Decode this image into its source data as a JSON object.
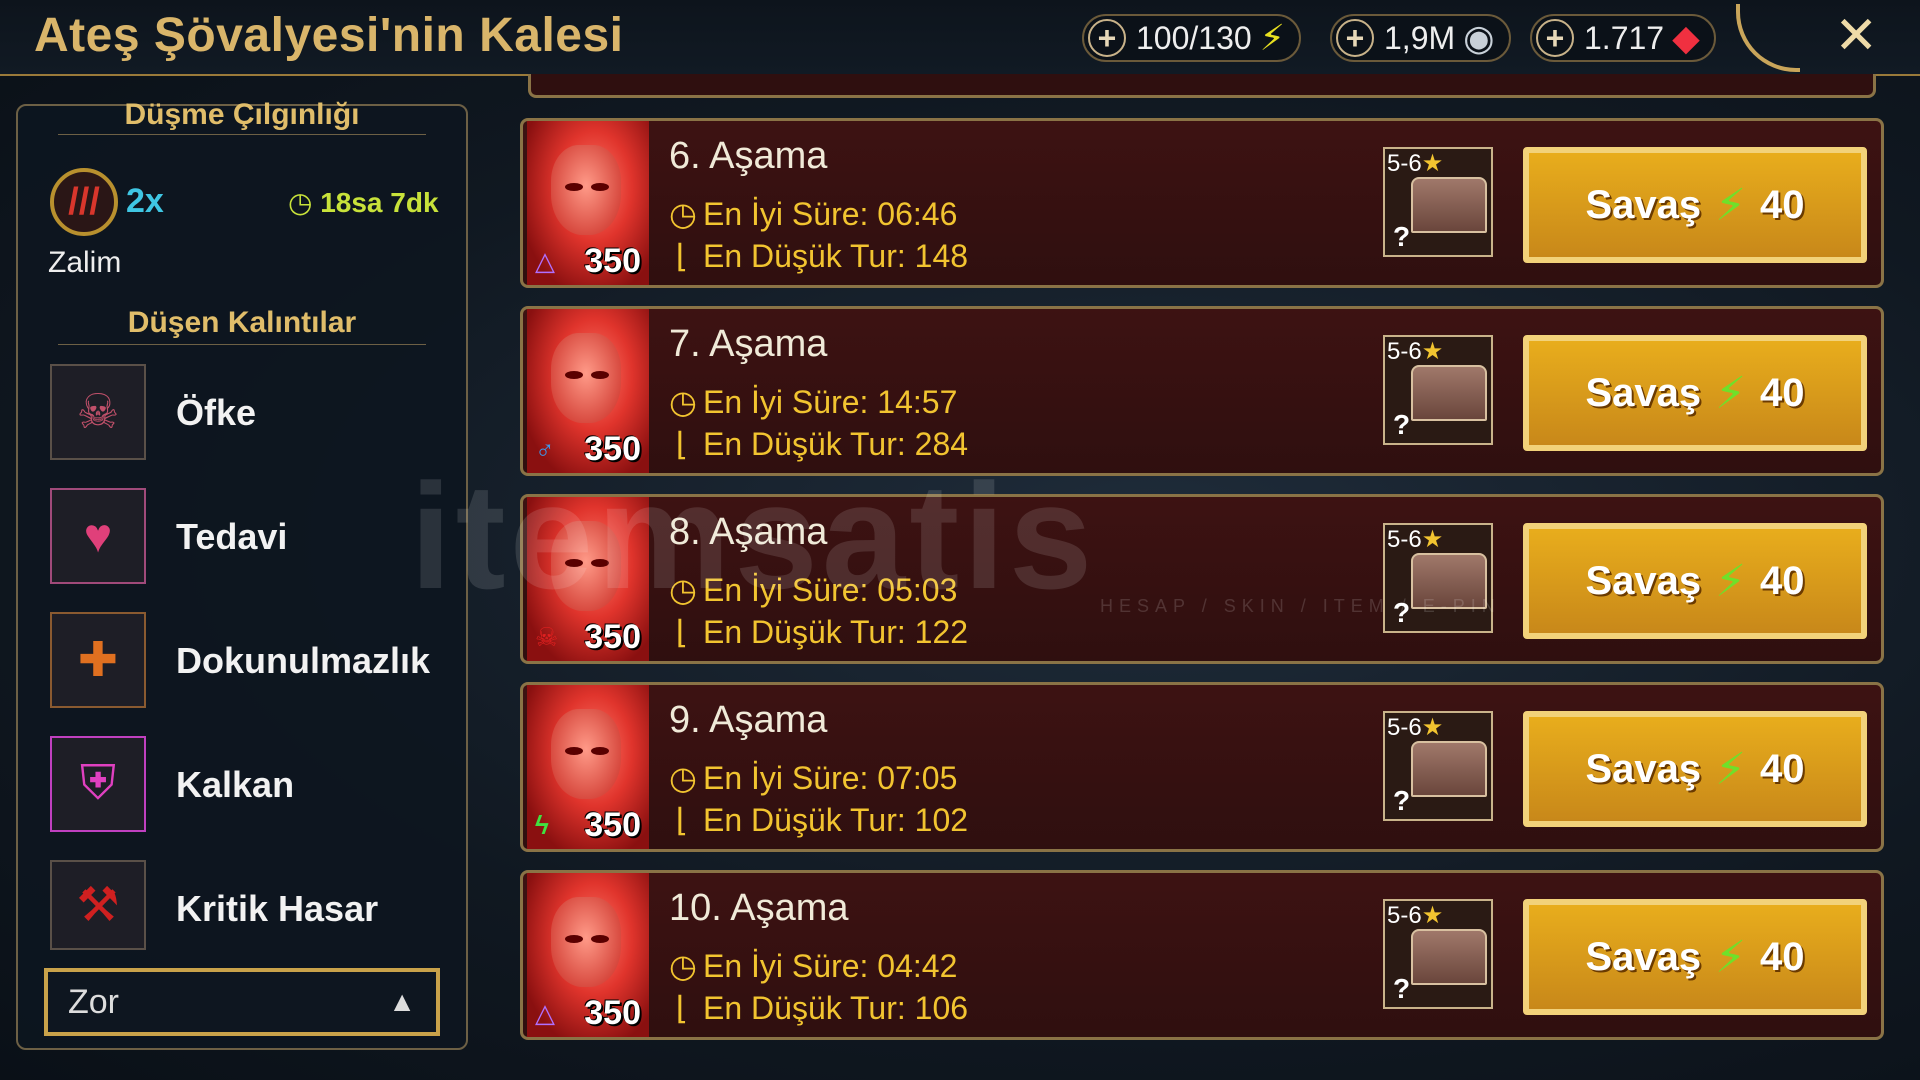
{
  "header": {
    "title": "Ateş Şövalyesi'nin Kalesi",
    "energy": "100/130",
    "silver": "1,9M",
    "gems": "1.717",
    "close_icon": "close-icon"
  },
  "sidebar": {
    "modifier_title": "Düşme Çılgınlığı",
    "multiplier": "2x",
    "timer": "18sa 7dk",
    "modifier_name": "Zalim",
    "relics_title": "Düşen Kalıntılar",
    "relics": [
      {
        "label": "Öfke",
        "icon": "skull-flame-icon",
        "color": "#c0506a"
      },
      {
        "label": "Tedavi",
        "icon": "heart-plus-icon",
        "color": "#e0407a"
      },
      {
        "label": "Dokunulmazlık",
        "icon": "shield-cross-icon",
        "color": "#e07020"
      },
      {
        "label": "Kalkan",
        "icon": "shield-icon",
        "color": "#e040c0"
      },
      {
        "label": "Kritik Hasar",
        "icon": "axe-icon",
        "color": "#d02020"
      }
    ],
    "difficulty": "Zor"
  },
  "stages": [
    {
      "name": "6. Aşama",
      "best_time": "En İyi Süre: 06:46",
      "min_turns": "En Düşük Tur: 148",
      "level": "350",
      "affinity": "△",
      "affinity_color": "#b070ff",
      "rank": "5-6",
      "button": "Savaş",
      "cost": "40"
    },
    {
      "name": "7. Aşama",
      "best_time": "En İyi Süre: 14:57",
      "min_turns": "En Düşük Tur: 284",
      "level": "350",
      "affinity": "♂",
      "affinity_color": "#3a9af0",
      "rank": "5-6",
      "button": "Savaş",
      "cost": "40"
    },
    {
      "name": "8. Aşama",
      "best_time": "En İyi Süre: 05:03",
      "min_turns": "En Düşük Tur: 122",
      "level": "350",
      "affinity": "☠",
      "affinity_color": "#e02020",
      "rank": "5-6",
      "button": "Savaş",
      "cost": "40"
    },
    {
      "name": "9. Aşama",
      "best_time": "En İyi Süre: 07:05",
      "min_turns": "En Düşük Tur: 102",
      "level": "350",
      "affinity": "ϟ",
      "affinity_color": "#40e040",
      "rank": "5-6",
      "button": "Savaş",
      "cost": "40"
    },
    {
      "name": "10. Aşama",
      "best_time": "En İyi Süre: 04:42",
      "min_turns": "En Düşük Tur: 106",
      "level": "350",
      "affinity": "△",
      "affinity_color": "#b070ff",
      "rank": "5-6",
      "button": "Savaş",
      "cost": "40"
    }
  ],
  "watermark": {
    "text": "itemsatis",
    "sub": "HESAP / SKIN / ITEM / E-PIN"
  }
}
